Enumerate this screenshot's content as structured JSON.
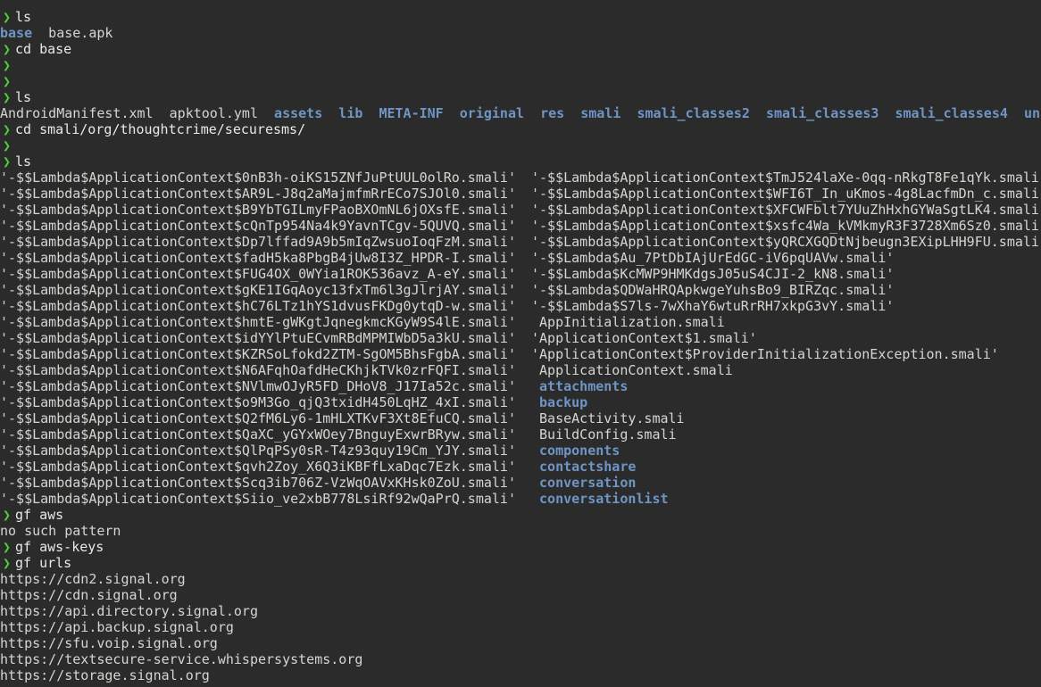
{
  "prompt_symbol": "❯",
  "lines": [
    {
      "kind": "prompt",
      "cmd": "ls"
    },
    {
      "kind": "row",
      "items": [
        {
          "t": "base",
          "c": "dir"
        },
        {
          "t": "  base.apk",
          "c": "file"
        }
      ]
    },
    {
      "kind": "prompt",
      "cmd": "cd base"
    },
    {
      "kind": "prompt",
      "cmd": ""
    },
    {
      "kind": "prompt",
      "cmd": ""
    },
    {
      "kind": "prompt",
      "cmd": "ls"
    },
    {
      "kind": "row",
      "items": [
        {
          "t": "AndroidManifest.xml  apktool.yml  ",
          "c": "file"
        },
        {
          "t": "assets",
          "c": "dir"
        },
        {
          "t": "  ",
          "c": "file"
        },
        {
          "t": "lib",
          "c": "dir"
        },
        {
          "t": "  ",
          "c": "file"
        },
        {
          "t": "META-INF",
          "c": "dir"
        },
        {
          "t": "  ",
          "c": "file"
        },
        {
          "t": "original",
          "c": "dir"
        },
        {
          "t": "  ",
          "c": "file"
        },
        {
          "t": "res",
          "c": "dir"
        },
        {
          "t": "  ",
          "c": "file"
        },
        {
          "t": "smali",
          "c": "dir"
        },
        {
          "t": "  ",
          "c": "file"
        },
        {
          "t": "smali_classes2",
          "c": "dir"
        },
        {
          "t": "  ",
          "c": "file"
        },
        {
          "t": "smali_classes3",
          "c": "dir"
        },
        {
          "t": "  ",
          "c": "file"
        },
        {
          "t": "smali_classes4",
          "c": "dir"
        },
        {
          "t": "  ",
          "c": "file"
        },
        {
          "t": "unknown",
          "c": "dir"
        }
      ]
    },
    {
      "kind": "prompt",
      "cmd": "cd smali/org/thoughtcrime/securesms/"
    },
    {
      "kind": "prompt",
      "cmd": ""
    },
    {
      "kind": "prompt",
      "cmd": "ls"
    },
    {
      "kind": "cols",
      "left": "'-$$Lambda$ApplicationContext$0nB3h-oiKS15ZNfJuPtUUL0olRo.smali'",
      "right": {
        "t": "'-$$Lambda$ApplicationContext$TmJ524laXe-0qq-nRkgT8Fe1qYk.smali'",
        "c": "file"
      }
    },
    {
      "kind": "cols",
      "left": "'-$$Lambda$ApplicationContext$AR9L-J8q2aMajmfmRrECo7SJOl0.smali'",
      "right": {
        "t": "'-$$Lambda$ApplicationContext$WFI6T_In_uKmos-4g8LacfmDn_c.smali'",
        "c": "file"
      }
    },
    {
      "kind": "cols",
      "left": "'-$$Lambda$ApplicationContext$B9YbTGILmyFPaoBXOmNL6jOXsfE.smali'",
      "right": {
        "t": "'-$$Lambda$ApplicationContext$XFCWFblt7YUuZhHxhGYWaSgtLK4.smali'",
        "c": "file"
      }
    },
    {
      "kind": "cols",
      "left": "'-$$Lambda$ApplicationContext$cQnTp954Na4k9YavnTCgv-5QUVQ.smali'",
      "right": {
        "t": "'-$$Lambda$ApplicationContext$xsfc4Wa_kVMkmyR3F3728Xm6Sz0.smali'",
        "c": "file"
      }
    },
    {
      "kind": "cols",
      "left": "'-$$Lambda$ApplicationContext$Dp7lffad9A9b5mIqZwsuoIoqFzM.smali'",
      "right": {
        "t": "'-$$Lambda$ApplicationContext$yQRCXGQDtNjbeugn3EXipLHH9FU.smali'",
        "c": "file"
      }
    },
    {
      "kind": "cols",
      "left": "'-$$Lambda$ApplicationContext$fadH5ka8PbgB4jUw8I3Z_HPDR-I.smali'",
      "right": {
        "t": "'-$$Lambda$Au_7PtDbIAjUrEdGC-iV6pqUAVw.smali'",
        "c": "file"
      }
    },
    {
      "kind": "cols",
      "left": "'-$$Lambda$ApplicationContext$FUG4OX_0WYia1ROK536avz_A-eY.smali'",
      "right": {
        "t": "'-$$Lambda$KcMWP9HMKdgsJ05uS4CJI-2_kN8.smali'",
        "c": "file"
      }
    },
    {
      "kind": "cols",
      "left": "'-$$Lambda$ApplicationContext$gKE1IGqAoyc13fxTm6l3gJlrjAY.smali'",
      "right": {
        "t": "'-$$Lambda$QDWaHRQApkwgeYuhsBo9_BIRZqc.smali'",
        "c": "file"
      }
    },
    {
      "kind": "cols",
      "left": "'-$$Lambda$ApplicationContext$hC76LTz1hYS1dvusFKDg0ytqD-w.smali'",
      "right": {
        "t": "'-$$Lambda$S7ls-7wXhaY6wtuRrRH7xkpG3vY.smali'",
        "c": "file"
      }
    },
    {
      "kind": "cols",
      "left": "'-$$Lambda$ApplicationContext$hmtE-gWKgtJqnegkmcKGyW9S4lE.smali'",
      "right": {
        "t": " AppInitialization.smali",
        "c": "file"
      }
    },
    {
      "kind": "cols",
      "left": "'-$$Lambda$ApplicationContext$idYYlPtuECvmRBdMPMIWbD5a3kU.smali'",
      "right": {
        "t": "'ApplicationContext$1.smali'",
        "c": "file"
      }
    },
    {
      "kind": "cols",
      "left": "'-$$Lambda$ApplicationContext$KZRSoLfokd2ZTM-SgOM5BhsFgbA.smali'",
      "right": {
        "t": "'ApplicationContext$ProviderInitializationException.smali'",
        "c": "file"
      }
    },
    {
      "kind": "cols",
      "left": "'-$$Lambda$ApplicationContext$N6AFqhOafdHeCKhjkTVk0zrFQFI.smali'",
      "right": {
        "t": " ApplicationContext.smali",
        "c": "file"
      }
    },
    {
      "kind": "cols",
      "left": "'-$$Lambda$ApplicationContext$NVlmwOJyR5FD_DHoV8_J17Ia52c.smali'",
      "right": {
        "t": " attachments",
        "c": "dir"
      }
    },
    {
      "kind": "cols",
      "left": "'-$$Lambda$ApplicationContext$o9M3Go_qjQ3txidH450LqHZ_4xI.smali'",
      "right": {
        "t": " backup",
        "c": "dir"
      }
    },
    {
      "kind": "cols",
      "left": "'-$$Lambda$ApplicationContext$Q2fM6Ly6-1mHLXTKvF3Xt8EfuCQ.smali'",
      "right": {
        "t": " BaseActivity.smali",
        "c": "file"
      }
    },
    {
      "kind": "cols",
      "left": "'-$$Lambda$ApplicationContext$QaXC_yGYxWOey7BnguyExwrBRyw.smali'",
      "right": {
        "t": " BuildConfig.smali",
        "c": "file"
      }
    },
    {
      "kind": "cols",
      "left": "'-$$Lambda$ApplicationContext$QlPqPSy0sR-T4z93quy19Cm_YJY.smali'",
      "right": {
        "t": " components",
        "c": "dir"
      }
    },
    {
      "kind": "cols",
      "left": "'-$$Lambda$ApplicationContext$qvh2Zoy_X6Q3iKBFfLxaDqc7Ezk.smali'",
      "right": {
        "t": " contactshare",
        "c": "dir"
      }
    },
    {
      "kind": "cols",
      "left": "'-$$Lambda$ApplicationContext$Scq3ib706Z-VzWqOAVxKHsk0ZoU.smali'",
      "right": {
        "t": " conversation",
        "c": "dir"
      }
    },
    {
      "kind": "cols",
      "left": "'-$$Lambda$ApplicationContext$Siio_ve2xbB778LsiRf92wQaPrQ.smali'",
      "right": {
        "t": " conversationlist",
        "c": "dir"
      }
    },
    {
      "kind": "prompt",
      "cmd": "gf aws"
    },
    {
      "kind": "out",
      "text": "no such pattern"
    },
    {
      "kind": "prompt",
      "cmd": "gf aws-keys"
    },
    {
      "kind": "prompt",
      "cmd": "gf urls"
    },
    {
      "kind": "out",
      "text": "https://cdn2.signal.org"
    },
    {
      "kind": "out",
      "text": "https://cdn.signal.org"
    },
    {
      "kind": "out",
      "text": "https://api.directory.signal.org"
    },
    {
      "kind": "out",
      "text": "https://api.backup.signal.org"
    },
    {
      "kind": "out",
      "text": "https://sfu.voip.signal.org"
    },
    {
      "kind": "out",
      "text": "https://textsecure-service.whispersystems.org"
    },
    {
      "kind": "out",
      "text": "https://storage.signal.org"
    }
  ],
  "colors": {
    "background": "#2b2b2b",
    "text": "#d3d7cf",
    "prompt": "#4cd137",
    "directory": "#6f95c4"
  }
}
